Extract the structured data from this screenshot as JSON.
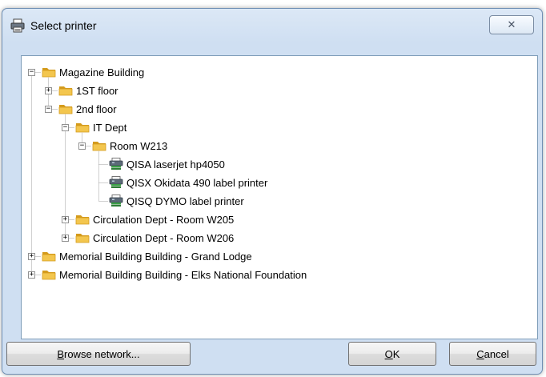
{
  "dialog": {
    "title": "Select printer",
    "close_symbol": "✕"
  },
  "tree": {
    "nodes": [
      {
        "label": "Magazine Building",
        "icon": "folder",
        "depth": 0,
        "expander": "minus"
      },
      {
        "label": "1ST floor",
        "icon": "folder",
        "depth": 1,
        "expander": "plus"
      },
      {
        "label": "2nd floor",
        "icon": "folder",
        "depth": 1,
        "expander": "minus"
      },
      {
        "label": "IT Dept",
        "icon": "folder",
        "depth": 2,
        "expander": "minus"
      },
      {
        "label": "Room W213",
        "icon": "folder",
        "depth": 3,
        "expander": "minus"
      },
      {
        "label": "QISA laserjet hp4050",
        "icon": "printer",
        "depth": 4,
        "expander": "none"
      },
      {
        "label": "QISX Okidata 490 label printer",
        "icon": "printer",
        "depth": 4,
        "expander": "none"
      },
      {
        "label": "QISQ DYMO label printer",
        "icon": "printer",
        "depth": 4,
        "expander": "none"
      },
      {
        "label": "Circulation Dept - Room W205",
        "icon": "folder",
        "depth": 2,
        "expander": "plus"
      },
      {
        "label": "Circulation Dept - Room W206",
        "icon": "folder",
        "depth": 2,
        "expander": "plus"
      },
      {
        "label": "Memorial Building Building - Grand Lodge",
        "icon": "folder",
        "depth": 0,
        "expander": "plus"
      },
      {
        "label": "Memorial Building Building - Elks National Foundation",
        "icon": "folder",
        "depth": 0,
        "expander": "plus"
      }
    ]
  },
  "buttons": {
    "browse": {
      "label": "Browse network...",
      "mnemonic": "B"
    },
    "ok": {
      "label": "OK",
      "mnemonic": "O"
    },
    "cancel": {
      "label": "Cancel",
      "mnemonic": "C"
    }
  },
  "colors": {
    "window_frame": "#cfdff2",
    "folder": "#f3c64e",
    "folder_dark": "#d49b1c"
  }
}
